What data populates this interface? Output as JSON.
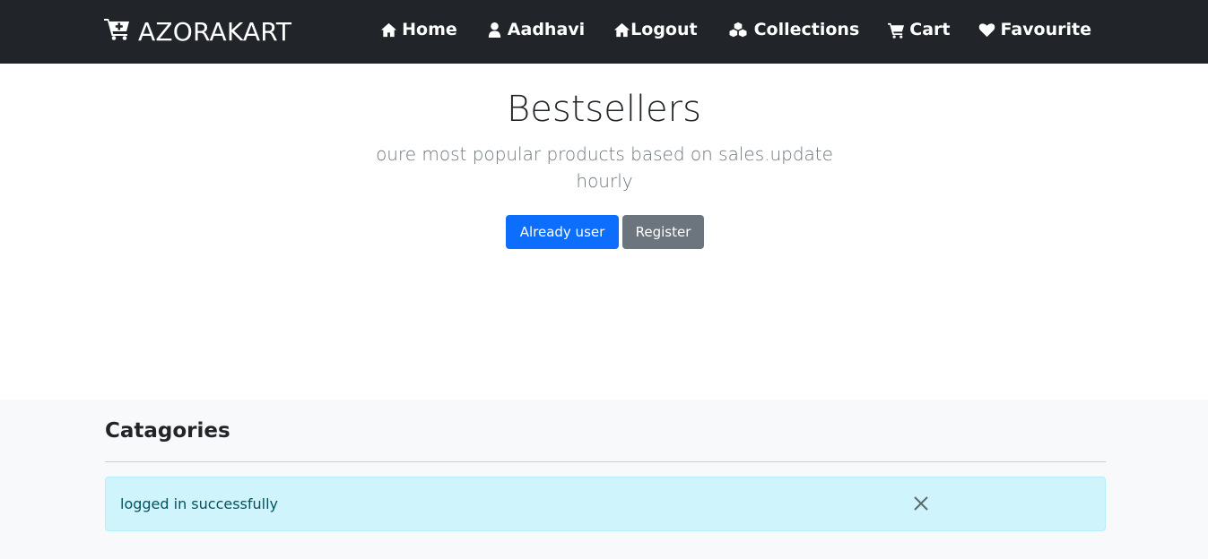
{
  "navbar": {
    "brand": "AZORAKART",
    "items": [
      {
        "label": "Home",
        "icon": "home-icon"
      },
      {
        "label": "Aadhavi",
        "icon": "user-icon"
      },
      {
        "label": "Logout",
        "icon": "home-icon"
      },
      {
        "label": "Collections",
        "icon": "cubes-icon"
      },
      {
        "label": "Cart",
        "icon": "cart-icon"
      },
      {
        "label": "Favourite",
        "icon": "heart-icon"
      }
    ]
  },
  "hero": {
    "title": "Bestsellers",
    "subtitle": "oure most popular products based on sales.update hourly",
    "buttons": {
      "login": "Already user",
      "register": "Register"
    }
  },
  "section": {
    "title": "Catagories",
    "alert": {
      "message": "logged in successfully"
    }
  },
  "colors": {
    "navbar_bg": "#212529",
    "primary": "#0d6efd",
    "secondary": "#6c757d",
    "alert_bg": "#cff4fc"
  }
}
